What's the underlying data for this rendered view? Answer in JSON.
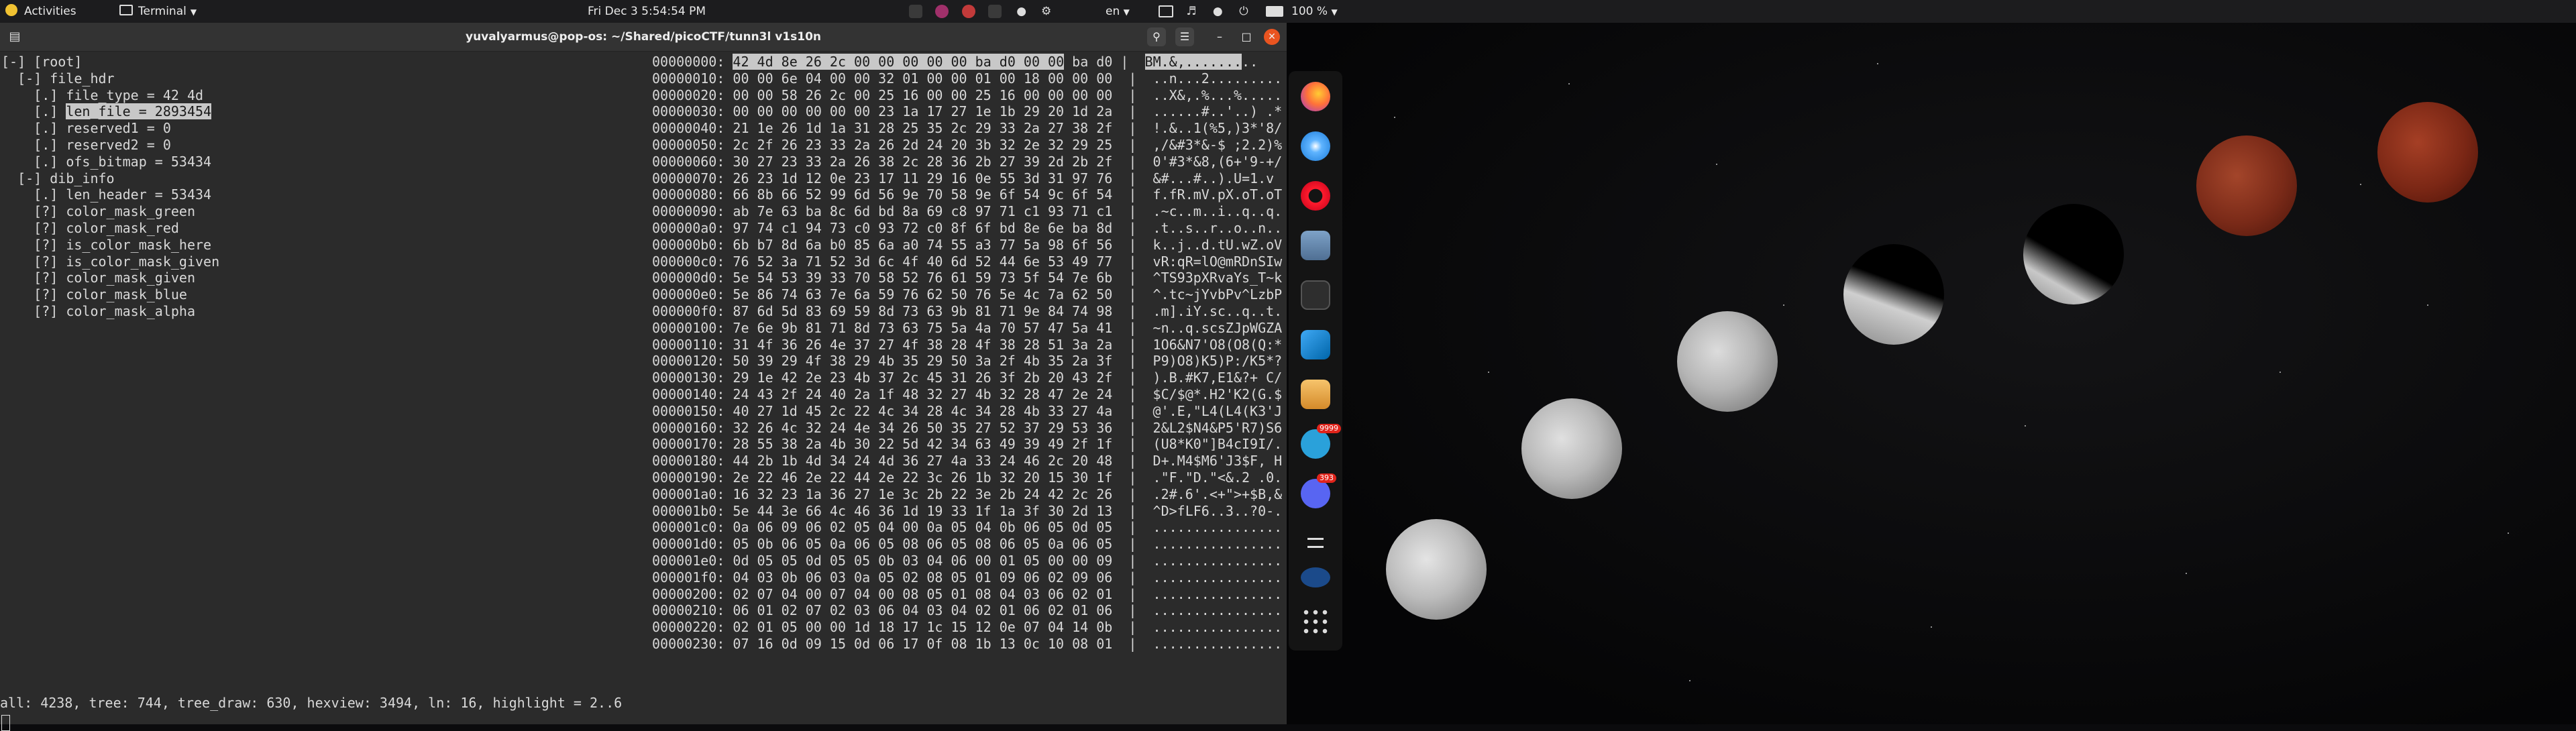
{
  "topbar": {
    "activities": "Activities",
    "app_name": "Terminal",
    "clock": "Fri Dec 3   5:54:54 PM",
    "language": "en",
    "battery": "100 %"
  },
  "window": {
    "title": "yuvalyarmus@pop-os: ~/Shared/picoCTF/tunn3l v1s10n"
  },
  "tree": [
    "[-] [root]",
    "  [-] file_hdr",
    "    [.] file_type = 42 4d",
    "    [.] len_file = 2893454",
    "    [.] reserved1 = 0",
    "    [.] reserved2 = 0",
    "    [.] ofs_bitmap = 53434",
    "  [-] dib_info",
    "    [.] len_header = 53434",
    "    [?] color_mask_green",
    "    [?] color_mask_red",
    "    [?] is_color_mask_here",
    "    [?] is_color_mask_given",
    "    [?] color_mask_given",
    "    [?] color_mask_blue",
    "    [?] color_mask_alpha"
  ],
  "tree_selected_index": 3,
  "hex_first": {
    "offset": "00000000:",
    "hl_bytes": "42 4d 8e 26 2c 00 00 00 00 00 ba d0 00 00",
    "rest_bytes": " ba d0",
    "sep": " |",
    "hl_ascii": "BM.&,.......",
    "rest_ascii": ".."
  },
  "hexdump": [
    "00000010: 00 00 6e 04 00 00 32 01 00 00 01 00 18 00 00 00  |  ..n...2.........",
    "00000020: 00 00 58 26 2c 00 25 16 00 00 25 16 00 00 00 00  |  ..X&,.%...%.....",
    "00000030: 00 00 00 00 00 00 23 1a 17 27 1e 1b 29 20 1d 2a  |  ......#..'..) .*",
    "00000040: 21 1e 26 1d 1a 31 28 25 35 2c 29 33 2a 27 38 2f  |  !.&..1(%5,)3*'8/",
    "00000050: 2c 2f 26 23 33 2a 26 2d 24 20 3b 32 2e 32 29 25  |  ,/&#3*&-$ ;2.2)%",
    "00000060: 30 27 23 33 2a 26 38 2c 28 36 2b 27 39 2d 2b 2f  |  0'#3*&8,(6+'9-+/",
    "00000070: 26 23 1d 12 0e 23 17 11 29 16 0e 55 3d 31 97 76  |  &#...#..).U=1.v",
    "00000080: 66 8b 66 52 99 6d 56 9e 70 58 9e 6f 54 9c 6f 54  |  f.fR.mV.pX.oT.oT",
    "00000090: ab 7e 63 ba 8c 6d bd 8a 69 c8 97 71 c1 93 71 c1  |  .~c..m..i..q..q.",
    "000000a0: 97 74 c1 94 73 c0 93 72 c0 8f 6f bd 8e 6e ba 8d  |  .t..s..r..o..n..",
    "000000b0: 6b b7 8d 6a b0 85 6a a0 74 55 a3 77 5a 98 6f 56  |  k..j..d.tU.wZ.oV",
    "000000c0: 76 52 3a 71 52 3d 6c 4f 40 6d 52 44 6e 53 49 77  |  vR:qR=lO@mRDnSIw",
    "000000d0: 5e 54 53 39 33 70 58 52 76 61 59 73 5f 54 7e 6b  |  ^TS93pXRvaYs_T~k",
    "000000e0: 5e 86 74 63 7e 6a 59 76 62 50 76 5e 4c 7a 62 50  |  ^.tc~jYvbPv^LzbP",
    "000000f0: 87 6d 5d 83 69 59 8d 73 63 9b 81 71 9e 84 74 98  |  .m].iY.sc..q..t.",
    "00000100: 7e 6e 9b 81 71 8d 73 63 75 5a 4a 70 57 47 5a 41  |  ~n..q.scsZJpWGZA",
    "00000110: 31 4f 36 26 4e 37 27 4f 38 28 4f 38 28 51 3a 2a  |  1O6&N7'O8(O8(Q:*",
    "00000120: 50 39 29 4f 38 29 4b 35 29 50 3a 2f 4b 35 2a 3f  |  P9)O8)K5)P:/K5*?",
    "00000130: 29 1e 42 2e 23 4b 37 2c 45 31 26 3f 2b 20 43 2f  |  ).B.#K7,E1&?+ C/",
    "00000140: 24 43 2f 24 40 2a 1f 48 32 27 4b 32 28 47 2e 24  |  $C/$@*.H2'K2(G.$",
    "00000150: 40 27 1d 45 2c 22 4c 34 28 4c 34 28 4b 33 27 4a  |  @'.E,\"L4(L4(K3'J",
    "00000160: 32 26 4c 32 24 4e 34 26 50 35 27 52 37 29 53 36  |  2&L2$N4&P5'R7)S6",
    "00000170: 28 55 38 2a 4b 30 22 5d 42 34 63 49 39 49 2f 1f  |  (U8*K0\"]B4cI9I/.",
    "00000180: 44 2b 1b 4d 34 24 4d 36 27 4a 33 24 46 2c 20 48  |  D+.M4$M6'J3$F, H",
    "00000190: 2e 22 46 2e 22 44 2e 22 3c 26 1b 32 20 15 30 1f  |  .\"F.\"D.\"<&.2 .0.",
    "000001a0: 16 32 23 1a 36 27 1e 3c 2b 22 3e 2b 24 42 2c 26  |  .2#.6'.<+\">+$B,&",
    "000001b0: 5e 44 3e 66 4c 46 36 1d 19 33 1f 1a 3f 30 2d 13  |  ^D>fLF6..3..?0-.",
    "000001c0: 0a 06 09 06 02 05 04 00 0a 05 04 0b 06 05 0d 05  |  ................",
    "000001d0: 05 0b 06 05 0a 06 05 08 06 05 08 06 05 0a 06 05  |  ................",
    "000001e0: 0d 05 05 0d 05 05 0b 03 04 06 00 01 05 00 00 09  |  ................",
    "000001f0: 04 03 0b 06 03 0a 05 02 08 05 01 09 06 02 09 06  |  ................",
    "00000200: 02 07 04 00 07 04 00 08 05 01 08 04 03 06 02 01  |  ................",
    "00000210: 06 01 02 07 02 03 06 04 03 04 02 01 06 02 01 06  |  ................",
    "00000220: 02 01 05 00 00 1d 18 17 1c 15 12 0e 07 04 14 0b  |  ................",
    "00000230: 07 16 0d 09 15 0d 06 17 0f 08 1b 13 0c 10 08 01  |  ................"
  ],
  "status_line": "all: 4238, tree: 744, tree_draw: 630, hexview: 3494, ln: 16, highlight = 2..6",
  "dock": {
    "telegram_badge": "9999",
    "discord_badge": "393"
  }
}
